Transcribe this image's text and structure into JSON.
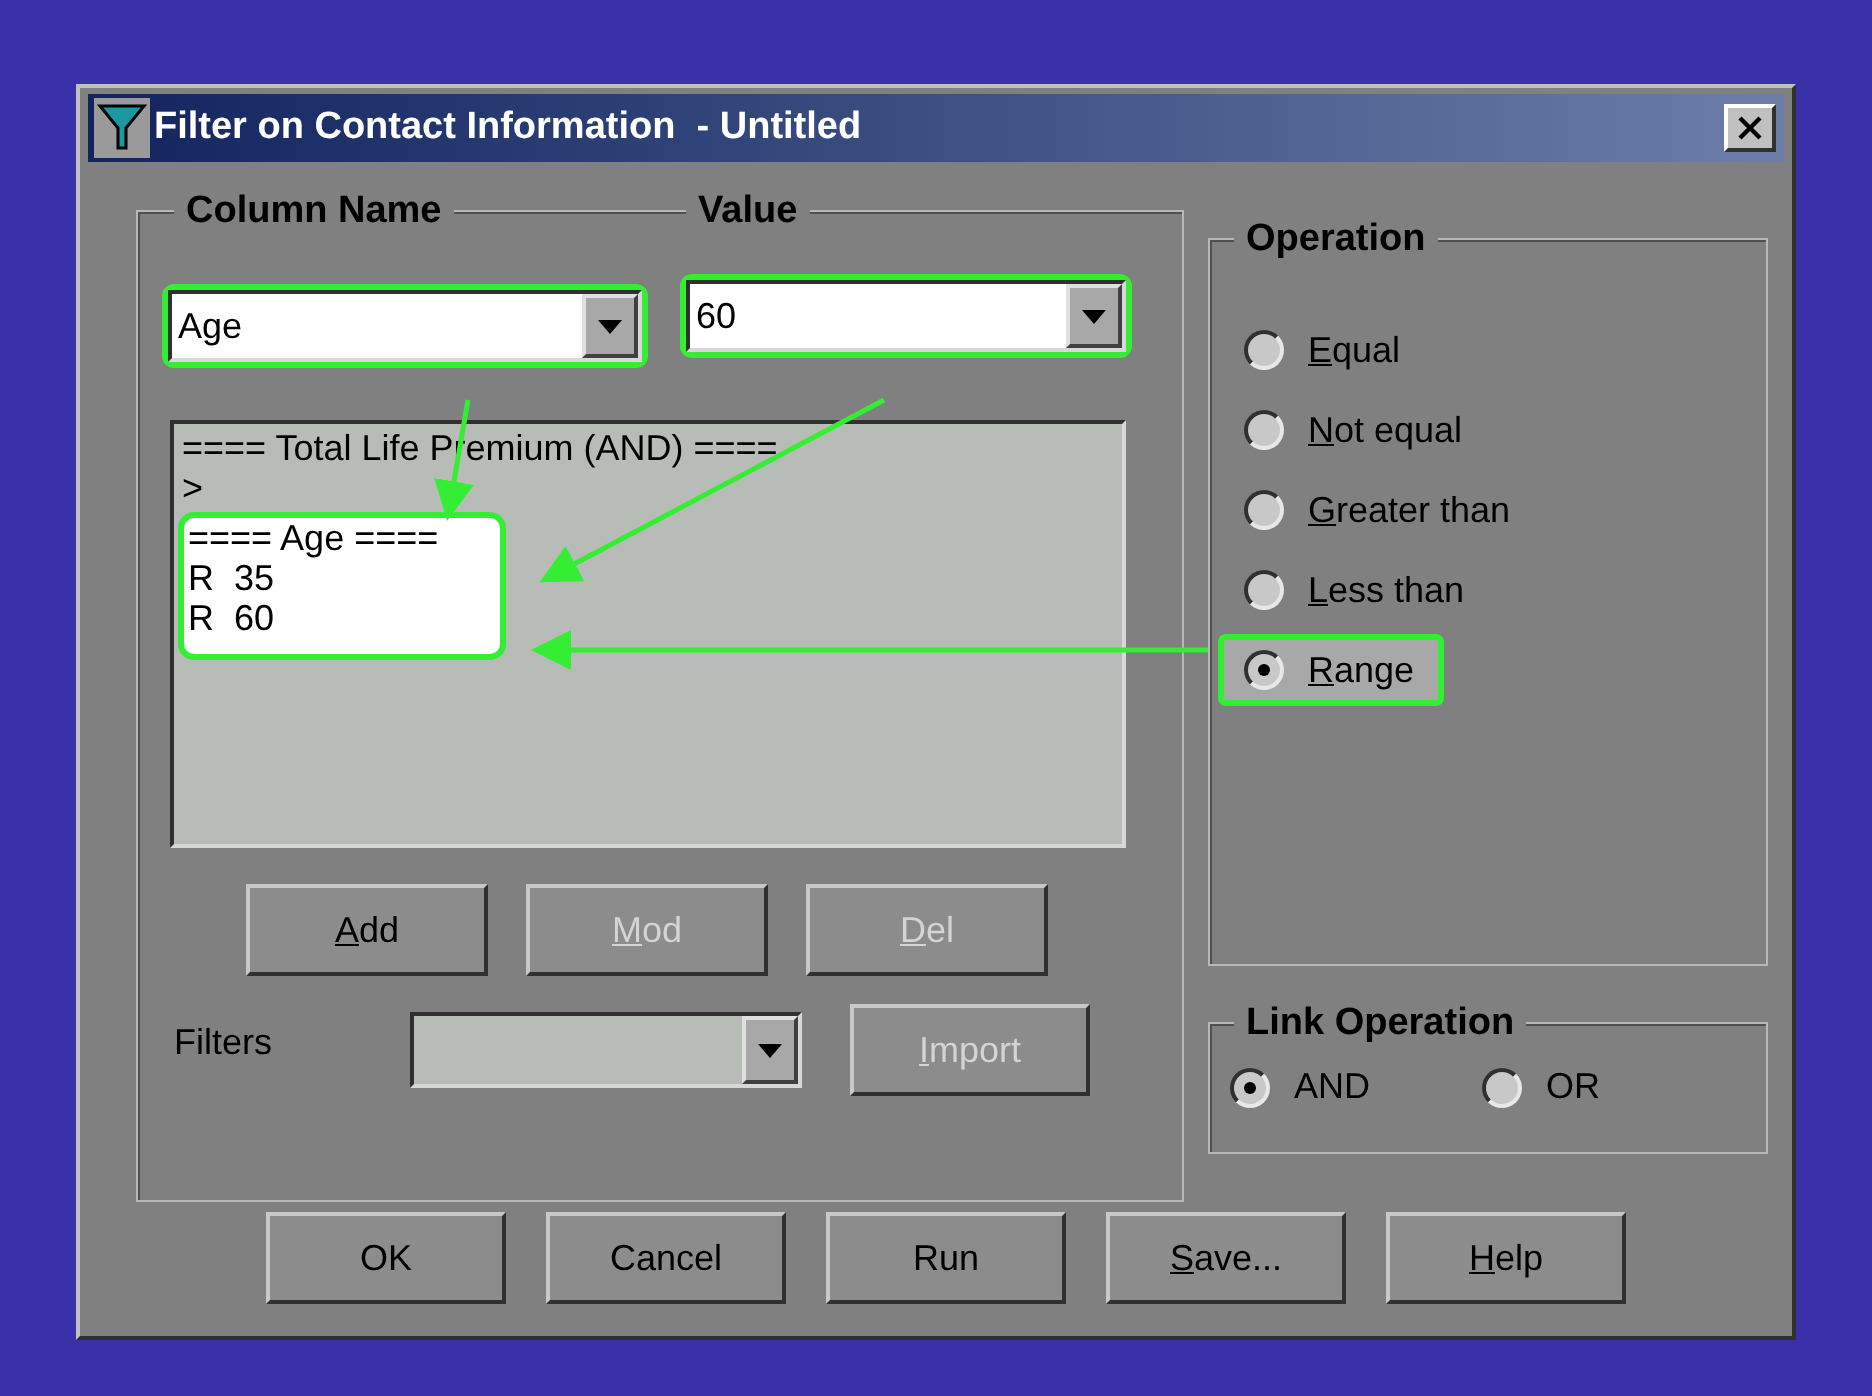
{
  "window": {
    "title": "Filter on Contact Information  - Untitled"
  },
  "column_name": {
    "label": "Column Name",
    "value": "Age",
    "highlighted": true
  },
  "value": {
    "label": "Value",
    "value": "60",
    "highlighted": true
  },
  "conditions": [
    {
      "text": "==== Total Life Premium (AND) ====",
      "highlighted": false
    },
    {
      "text": ">",
      "highlighted": false
    },
    {
      "text": "==== Age ====",
      "highlighted": true
    },
    {
      "text": "R  35",
      "highlighted": true
    },
    {
      "text": "R  60",
      "highlighted": true
    }
  ],
  "list_buttons": [
    {
      "label": "Add",
      "disabled": false,
      "underline_first": true
    },
    {
      "label": "Mod",
      "disabled": true,
      "underline_first": true
    },
    {
      "label": "Del",
      "disabled": true,
      "underline_first": true
    }
  ],
  "filters": {
    "label": "Filters",
    "disabled": true
  },
  "import_button": {
    "label": "Import",
    "disabled": true,
    "underline_first": true
  },
  "operation": {
    "title": "Operation",
    "options": [
      {
        "label": "Equal",
        "selected": false,
        "highlighted": false,
        "underline_first": true
      },
      {
        "label": "Not equal",
        "selected": false,
        "highlighted": false,
        "underline_first": true
      },
      {
        "label": "Greater than",
        "selected": false,
        "highlighted": false,
        "underline_first": true
      },
      {
        "label": "Less than",
        "selected": false,
        "highlighted": false,
        "underline_first": true
      },
      {
        "label": "Range",
        "selected": true,
        "highlighted": true,
        "underline_first": true
      }
    ]
  },
  "link_operation": {
    "title": "Link Operation",
    "options": [
      {
        "label": "AND",
        "selected": true
      },
      {
        "label": "OR",
        "selected": false
      }
    ]
  },
  "buttons": [
    {
      "label": "OK",
      "underline_first": false
    },
    {
      "label": "Cancel",
      "underline_first": false
    },
    {
      "label": "Run",
      "underline_first": false
    },
    {
      "label": "Save...",
      "underline_first": true
    },
    {
      "label": "Help",
      "underline_first": true
    }
  ]
}
